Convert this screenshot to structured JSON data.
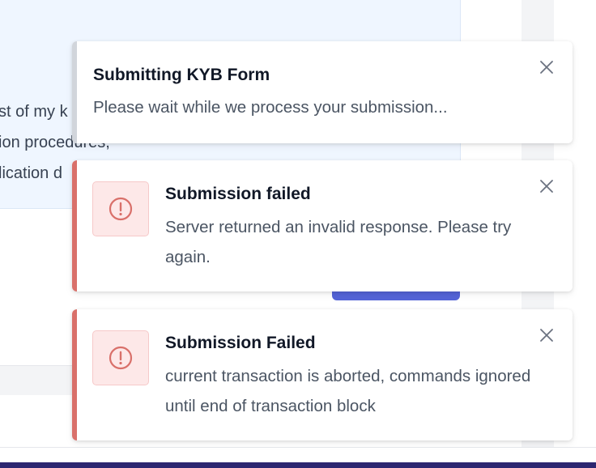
{
  "background": {
    "info_lines": [
      "st of my k",
      "ion procedures,",
      "lication d"
    ]
  },
  "toasts": [
    {
      "title": "Submitting KYB Form",
      "message": "Please wait while we process your submission...",
      "status": "loading",
      "close_icon": "close-icon"
    },
    {
      "title": "Submission failed",
      "message": "Server returned an invalid response. Please try again.",
      "status": "error",
      "icon": "alert-circle-icon",
      "close_icon": "close-icon"
    },
    {
      "title": "Submission Failed",
      "message": "current transaction is aborted, commands ignored until end of transaction block",
      "status": "error",
      "icon": "alert-circle-icon",
      "close_icon": "close-icon"
    }
  ],
  "colors": {
    "error_accent": "#d9706a",
    "neutral_accent": "#d1d5db",
    "icon_bg": "#fde8e8",
    "bottom_bar": "#2c2670",
    "bg_button": "#5464d8"
  }
}
